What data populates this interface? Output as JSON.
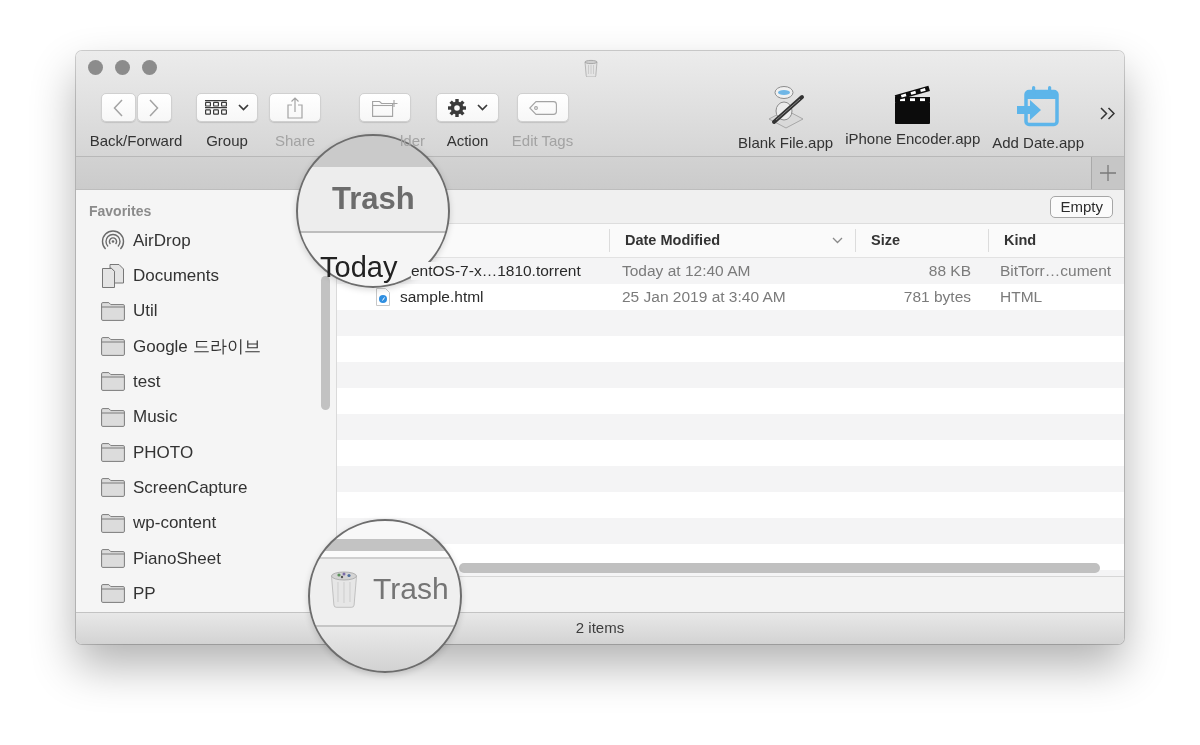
{
  "window": {
    "active": false
  },
  "toolbar": {
    "items": [
      {
        "kind": "back_forward",
        "label": "Back/Forward",
        "back_disabled": true,
        "forward_disabled": true
      },
      {
        "kind": "group",
        "label": "Group",
        "disabled": false
      },
      {
        "kind": "share",
        "label": "Share",
        "disabled": true
      },
      {
        "kind": "new_folder",
        "label": "lder",
        "disabled": true
      },
      {
        "kind": "action",
        "label": "Action",
        "disabled": false
      },
      {
        "kind": "edit_tags",
        "label": "Edit Tags",
        "disabled": true
      }
    ],
    "apps": [
      {
        "kind": "robot",
        "label": "Blank File.app"
      },
      {
        "kind": "clapperboard",
        "label": "iPhone Encoder.app"
      },
      {
        "kind": "calendar",
        "label": "Add Date.app"
      }
    ]
  },
  "sidebar": {
    "section": "Favorites",
    "items": [
      {
        "kind": "airdrop",
        "label": "AirDrop",
        "selected": false
      },
      {
        "kind": "documents",
        "label": "Documents",
        "selected": false
      },
      {
        "kind": "folder",
        "label": "Util",
        "selected": false
      },
      {
        "kind": "folder",
        "label": "Google 드라이브",
        "selected": false
      },
      {
        "kind": "folder",
        "label": "test",
        "selected": false
      },
      {
        "kind": "folder",
        "label": "Music",
        "selected": false
      },
      {
        "kind": "folder",
        "label": "PHOTO",
        "selected": false
      },
      {
        "kind": "folder",
        "label": "ScreenCapture",
        "selected": false
      },
      {
        "kind": "folder",
        "label": "wp-content",
        "selected": false
      },
      {
        "kind": "folder",
        "label": "PianoSheet",
        "selected": false
      },
      {
        "kind": "folder",
        "label": "PP",
        "selected": false
      }
    ]
  },
  "content": {
    "empty_button": "Empty",
    "columns": [
      {
        "label": "Date Modified",
        "sorted": true
      },
      {
        "label": "Size",
        "sorted": false
      },
      {
        "label": "Kind",
        "sorted": false
      }
    ],
    "rows": [
      {
        "name": "entOS-7-x…1810.torrent",
        "date_modified": "Today at 12:40 AM",
        "size": "88 KB",
        "file_kind": "BitTorr…cument",
        "selected": false
      },
      {
        "kind": "html_file",
        "name": "sample.html",
        "date_modified": "25 Jan 2019 at 3:40 AM",
        "size": "781 bytes",
        "file_kind": "HTML",
        "selected": false
      }
    ]
  },
  "status_bar": {
    "text": "2 items"
  },
  "magnifiers": [
    {
      "kind": "tab",
      "title": "Trash",
      "group_header": "Today"
    },
    {
      "kind": "path",
      "label": "Trash"
    }
  ]
}
